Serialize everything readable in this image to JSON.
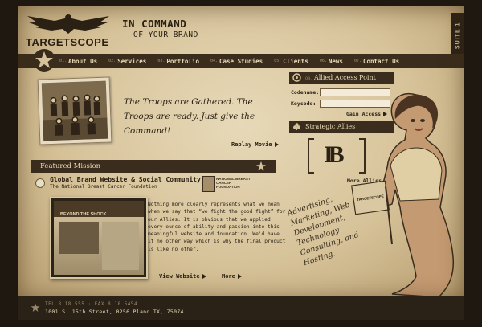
{
  "brand": {
    "logo_text": "TARGETSCOPE",
    "tagline_line1": "IN COMMAND",
    "tagline_line2": "OF YOUR BRAND",
    "side_tab": "SUITE 1"
  },
  "nav": {
    "items": [
      {
        "num": "01.",
        "label": "About Us"
      },
      {
        "num": "02.",
        "label": "Services"
      },
      {
        "num": "03.",
        "label": "Portfolio"
      },
      {
        "num": "04.",
        "label": "Case Studies"
      },
      {
        "num": "05.",
        "label": "Clients"
      },
      {
        "num": "06.",
        "label": "News"
      },
      {
        "num": "07.",
        "label": "Contact Us"
      }
    ]
  },
  "hero": {
    "text": "The Troops are Gathered. The Troops are ready. Just give the Command!",
    "replay_label": "Replay Movie"
  },
  "featured": {
    "title": "Featured Mission",
    "headline": "Global Brand Website & Social Community",
    "subhead": "The National Breast Cancer Foundation",
    "partner_logo_text": "NATIONAL BREAST CANCER FOUNDATION",
    "screenshot_title": "BEYOND THE SHOCK",
    "description": "Nothing more clearly represents what we mean when we say that “we fight the good fight” for our Allies. It is obvious that we applied every ounce of ability and passion into this meaningful website and foundation. We'd have it no other way which is why the final product is like no other.",
    "view_label": "View Website",
    "more_label": "More"
  },
  "access": {
    "num": "08.",
    "title": "Allied Access Point",
    "codename_label": "Codename:",
    "keycode_label": "Keycode:",
    "codename_value": "",
    "keycode_value": "",
    "gain_label": "Gain Access"
  },
  "allies": {
    "title": "Strategic Allies",
    "logo_text": "IB",
    "more_label": "More Allies"
  },
  "figure": {
    "flag_text": "TARGETSCOPE"
  },
  "services_script": "Advertising, Marketing, Web Development, Technology Consulting, and Hosting.",
  "footer": {
    "line1": "TEL 8.18.555 · FAX 8.18.5454",
    "line2": "1001 S. 15th Street, 0256 Plano TX, 75074"
  },
  "colors": {
    "paper": "#d7c39a",
    "dark": "#3a2d1d",
    "ink": "#2b2115"
  }
}
